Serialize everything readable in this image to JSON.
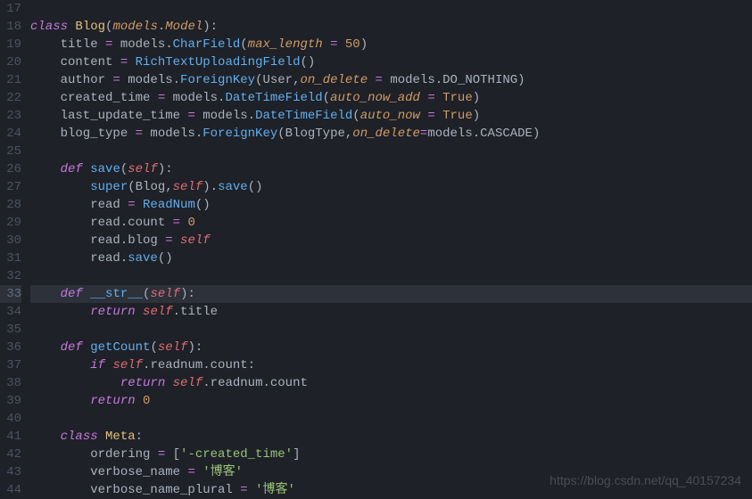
{
  "line_numbers": [
    "17",
    "18",
    "19",
    "20",
    "21",
    "22",
    "23",
    "24",
    "25",
    "26",
    "27",
    "28",
    "29",
    "30",
    "31",
    "32",
    "33",
    "34",
    "35",
    "36",
    "37",
    "38",
    "39",
    "40",
    "41",
    "42",
    "43",
    "44"
  ],
  "highlight_line": "33",
  "watermark": "https://blog.csdn.net/qq_40157234",
  "lines": {
    "17": [],
    "18": [
      {
        "cls": "kw",
        "t": "class"
      },
      {
        "cls": "pl",
        "t": " "
      },
      {
        "cls": "cls",
        "t": "Blog"
      },
      {
        "cls": "pn",
        "t": "("
      },
      {
        "cls": "param",
        "t": "models"
      },
      {
        "cls": "pn",
        "t": "."
      },
      {
        "cls": "param",
        "t": "Model"
      },
      {
        "cls": "pn",
        "t": "):"
      }
    ],
    "19": [
      {
        "cls": "pl",
        "t": "    title "
      },
      {
        "cls": "op",
        "t": "="
      },
      {
        "cls": "pl",
        "t": " models."
      },
      {
        "cls": "fn",
        "t": "CharField"
      },
      {
        "cls": "pn",
        "t": "("
      },
      {
        "cls": "param",
        "t": "max_length"
      },
      {
        "cls": "pl",
        "t": " "
      },
      {
        "cls": "op",
        "t": "="
      },
      {
        "cls": "pl",
        "t": " "
      },
      {
        "cls": "num",
        "t": "50"
      },
      {
        "cls": "pn",
        "t": ")"
      }
    ],
    "20": [
      {
        "cls": "pl",
        "t": "    content "
      },
      {
        "cls": "op",
        "t": "="
      },
      {
        "cls": "pl",
        "t": " "
      },
      {
        "cls": "fn",
        "t": "RichTextUploadingField"
      },
      {
        "cls": "pn",
        "t": "()"
      }
    ],
    "21": [
      {
        "cls": "pl",
        "t": "    author "
      },
      {
        "cls": "op",
        "t": "="
      },
      {
        "cls": "pl",
        "t": " models."
      },
      {
        "cls": "fn",
        "t": "ForeignKey"
      },
      {
        "cls": "pn",
        "t": "("
      },
      {
        "cls": "pl",
        "t": "User,"
      },
      {
        "cls": "param",
        "t": "on_delete"
      },
      {
        "cls": "pl",
        "t": " "
      },
      {
        "cls": "op",
        "t": "="
      },
      {
        "cls": "pl",
        "t": " models.DO_NOTHING"
      },
      {
        "cls": "pn",
        "t": ")"
      }
    ],
    "22": [
      {
        "cls": "pl",
        "t": "    created_time "
      },
      {
        "cls": "op",
        "t": "="
      },
      {
        "cls": "pl",
        "t": " models."
      },
      {
        "cls": "fn",
        "t": "DateTimeField"
      },
      {
        "cls": "pn",
        "t": "("
      },
      {
        "cls": "param",
        "t": "auto_now_add"
      },
      {
        "cls": "pl",
        "t": " "
      },
      {
        "cls": "op",
        "t": "="
      },
      {
        "cls": "pl",
        "t": " "
      },
      {
        "cls": "const",
        "t": "True"
      },
      {
        "cls": "pn",
        "t": ")"
      }
    ],
    "23": [
      {
        "cls": "pl",
        "t": "    last_update_time "
      },
      {
        "cls": "op",
        "t": "="
      },
      {
        "cls": "pl",
        "t": " models."
      },
      {
        "cls": "fn",
        "t": "DateTimeField"
      },
      {
        "cls": "pn",
        "t": "("
      },
      {
        "cls": "param",
        "t": "auto_now"
      },
      {
        "cls": "pl",
        "t": " "
      },
      {
        "cls": "op",
        "t": "="
      },
      {
        "cls": "pl",
        "t": " "
      },
      {
        "cls": "const",
        "t": "True"
      },
      {
        "cls": "pn",
        "t": ")"
      }
    ],
    "24": [
      {
        "cls": "pl",
        "t": "    blog_type "
      },
      {
        "cls": "op",
        "t": "="
      },
      {
        "cls": "pl",
        "t": " models."
      },
      {
        "cls": "fn",
        "t": "ForeignKey"
      },
      {
        "cls": "pn",
        "t": "("
      },
      {
        "cls": "pl",
        "t": "BlogType,"
      },
      {
        "cls": "param",
        "t": "on_delete"
      },
      {
        "cls": "op",
        "t": "="
      },
      {
        "cls": "pl",
        "t": "models.CASCADE"
      },
      {
        "cls": "pn",
        "t": ")"
      }
    ],
    "25": [],
    "26": [
      {
        "cls": "pl",
        "t": "    "
      },
      {
        "cls": "kw",
        "t": "def"
      },
      {
        "cls": "pl",
        "t": " "
      },
      {
        "cls": "fn",
        "t": "save"
      },
      {
        "cls": "pn",
        "t": "("
      },
      {
        "cls": "self",
        "t": "self"
      },
      {
        "cls": "pn",
        "t": "):"
      }
    ],
    "27": [
      {
        "cls": "pl",
        "t": "        "
      },
      {
        "cls": "fn",
        "t": "super"
      },
      {
        "cls": "pn",
        "t": "("
      },
      {
        "cls": "pl",
        "t": "Blog,"
      },
      {
        "cls": "self",
        "t": "self"
      },
      {
        "cls": "pn",
        "t": ")."
      },
      {
        "cls": "fn",
        "t": "save"
      },
      {
        "cls": "pn",
        "t": "()"
      }
    ],
    "28": [
      {
        "cls": "pl",
        "t": "        read "
      },
      {
        "cls": "op",
        "t": "="
      },
      {
        "cls": "pl",
        "t": " "
      },
      {
        "cls": "fn",
        "t": "ReadNum"
      },
      {
        "cls": "pn",
        "t": "()"
      }
    ],
    "29": [
      {
        "cls": "pl",
        "t": "        read.count "
      },
      {
        "cls": "op",
        "t": "="
      },
      {
        "cls": "pl",
        "t": " "
      },
      {
        "cls": "num",
        "t": "0"
      }
    ],
    "30": [
      {
        "cls": "pl",
        "t": "        read.blog "
      },
      {
        "cls": "op",
        "t": "="
      },
      {
        "cls": "pl",
        "t": " "
      },
      {
        "cls": "self",
        "t": "self"
      }
    ],
    "31": [
      {
        "cls": "pl",
        "t": "        read."
      },
      {
        "cls": "fn",
        "t": "save"
      },
      {
        "cls": "pn",
        "t": "()"
      }
    ],
    "32": [],
    "33": [
      {
        "cls": "pl",
        "t": "    "
      },
      {
        "cls": "kw",
        "t": "def"
      },
      {
        "cls": "pl",
        "t": " "
      },
      {
        "cls": "fn",
        "t": "__str__"
      },
      {
        "cls": "pn",
        "t": "("
      },
      {
        "cls": "self",
        "t": "self"
      },
      {
        "cls": "pn",
        "t": "):"
      }
    ],
    "34": [
      {
        "cls": "pl",
        "t": "        "
      },
      {
        "cls": "kw",
        "t": "return"
      },
      {
        "cls": "pl",
        "t": " "
      },
      {
        "cls": "self",
        "t": "self"
      },
      {
        "cls": "pl",
        "t": ".title"
      }
    ],
    "35": [],
    "36": [
      {
        "cls": "pl",
        "t": "    "
      },
      {
        "cls": "kw",
        "t": "def"
      },
      {
        "cls": "pl",
        "t": " "
      },
      {
        "cls": "fn",
        "t": "getCount"
      },
      {
        "cls": "pn",
        "t": "("
      },
      {
        "cls": "self",
        "t": "self"
      },
      {
        "cls": "pn",
        "t": "):"
      }
    ],
    "37": [
      {
        "cls": "pl",
        "t": "        "
      },
      {
        "cls": "kw",
        "t": "if"
      },
      {
        "cls": "pl",
        "t": " "
      },
      {
        "cls": "self",
        "t": "self"
      },
      {
        "cls": "pl",
        "t": ".readnum.count:"
      }
    ],
    "38": [
      {
        "cls": "pl",
        "t": "            "
      },
      {
        "cls": "kw",
        "t": "return"
      },
      {
        "cls": "pl",
        "t": " "
      },
      {
        "cls": "self",
        "t": "self"
      },
      {
        "cls": "pl",
        "t": ".readnum.count"
      }
    ],
    "39": [
      {
        "cls": "pl",
        "t": "        "
      },
      {
        "cls": "kw",
        "t": "return"
      },
      {
        "cls": "pl",
        "t": " "
      },
      {
        "cls": "num",
        "t": "0"
      }
    ],
    "40": [],
    "41": [
      {
        "cls": "pl",
        "t": "    "
      },
      {
        "cls": "kw",
        "t": "class"
      },
      {
        "cls": "pl",
        "t": " "
      },
      {
        "cls": "cls",
        "t": "Meta"
      },
      {
        "cls": "pn",
        "t": ":"
      }
    ],
    "42": [
      {
        "cls": "pl",
        "t": "        ordering "
      },
      {
        "cls": "op",
        "t": "="
      },
      {
        "cls": "pl",
        "t": " ["
      },
      {
        "cls": "str",
        "t": "'-created_time'"
      },
      {
        "cls": "pl",
        "t": "]"
      }
    ],
    "43": [
      {
        "cls": "pl",
        "t": "        verbose_name "
      },
      {
        "cls": "op",
        "t": "="
      },
      {
        "cls": "pl",
        "t": " "
      },
      {
        "cls": "str",
        "t": "'博客'"
      }
    ],
    "44": [
      {
        "cls": "pl",
        "t": "        verbose_name_plural "
      },
      {
        "cls": "op",
        "t": "="
      },
      {
        "cls": "pl",
        "t": " "
      },
      {
        "cls": "str",
        "t": "'博客'"
      }
    ]
  }
}
